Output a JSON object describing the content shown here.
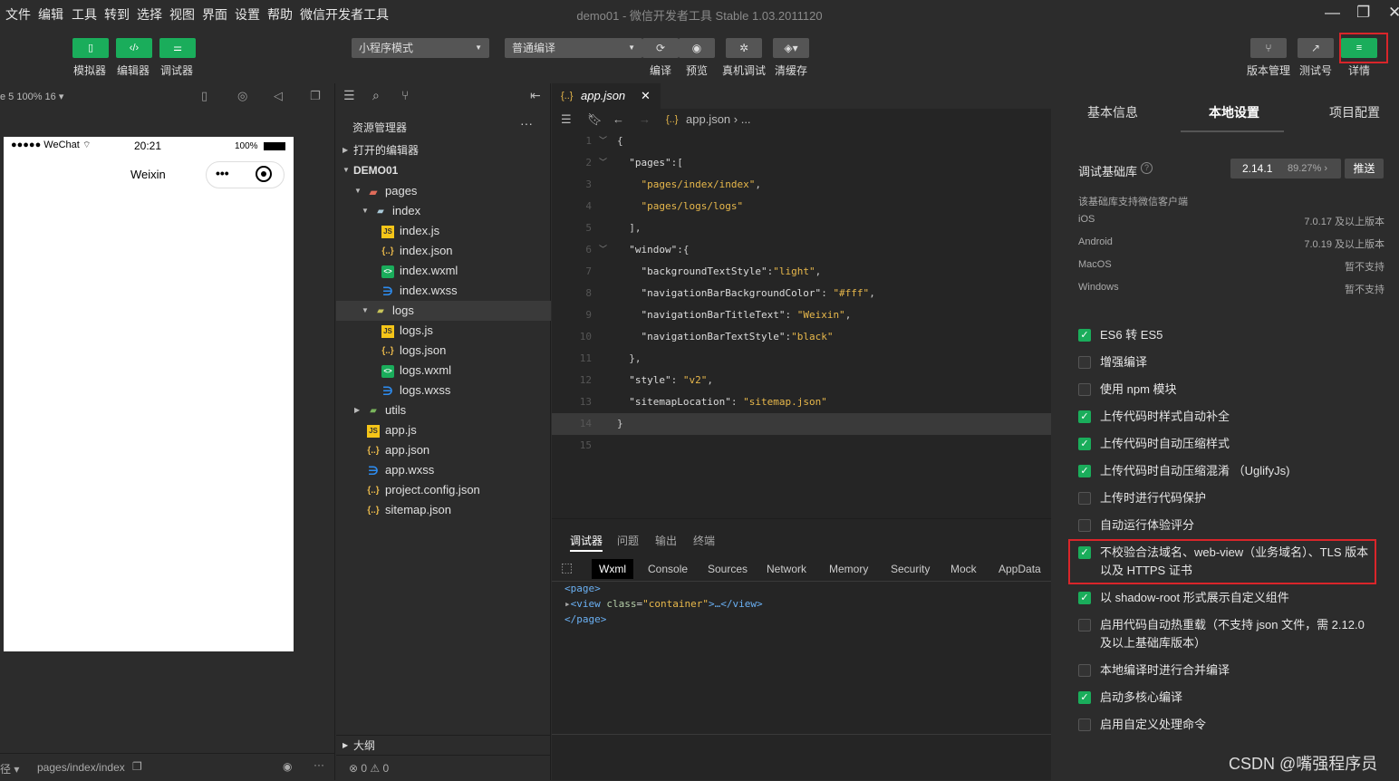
{
  "menubar": {
    "items": [
      "文件",
      "编辑",
      "工具",
      "转到",
      "选择",
      "视图",
      "界面",
      "设置",
      "帮助",
      "微信开发者工具"
    ],
    "title": "demo01 - 微信开发者工具 Stable 1.03.2011120"
  },
  "toolbar": {
    "simulator": "模拟器",
    "editor": "编辑器",
    "debugger": "调试器",
    "mode_select": "小程序模式",
    "compile_select": "普通编译",
    "compile": "编译",
    "preview": "预览",
    "real_debug": "真机调试",
    "clear_cache": "清缓存",
    "version_mgmt": "版本管理",
    "test_id": "测试号",
    "details": "详情"
  },
  "simulator": {
    "zoom": "e 5 100% 16 ▾",
    "carrier": "●●●●● WeChat",
    "time": "20:21",
    "battery": "100%",
    "nav_title": "Weixin",
    "footer_left": "径 ▾",
    "footer_path": "pages/index/index"
  },
  "explorer": {
    "title": "资源管理器",
    "more": "···",
    "open_editors": "打开的编辑器",
    "project": "DEMO01",
    "tree": [
      {
        "label": "pages",
        "type": "folder",
        "level": 1
      },
      {
        "label": "index",
        "type": "folder2",
        "level": 2
      },
      {
        "label": "index.js",
        "type": "js",
        "level": 3
      },
      {
        "label": "index.json",
        "type": "json",
        "level": 3
      },
      {
        "label": "index.wxml",
        "type": "wxml",
        "level": 3
      },
      {
        "label": "index.wxss",
        "type": "wxss",
        "level": 3
      },
      {
        "label": "logs",
        "type": "folder3",
        "level": 2
      },
      {
        "label": "logs.js",
        "type": "js",
        "level": 3
      },
      {
        "label": "logs.json",
        "type": "json",
        "level": 3
      },
      {
        "label": "logs.wxml",
        "type": "wxml",
        "level": 3
      },
      {
        "label": "logs.wxss",
        "type": "wxss",
        "level": 3
      },
      {
        "label": "utils",
        "type": "folder4",
        "level": 1
      },
      {
        "label": "app.js",
        "type": "js",
        "level": 1
      },
      {
        "label": "app.json",
        "type": "json",
        "level": 1
      },
      {
        "label": "app.wxss",
        "type": "wxss",
        "level": 1
      },
      {
        "label": "project.config.json",
        "type": "json",
        "level": 1
      },
      {
        "label": "sitemap.json",
        "type": "json",
        "level": 1
      }
    ],
    "outline": "大纲",
    "status": "⊗ 0 ⚠ 0"
  },
  "editor": {
    "tab": "app.json",
    "breadcrumb": "app.json › ...",
    "lines": [
      {
        "n": "1",
        "code": "{"
      },
      {
        "n": "2",
        "code": "  \"pages\":["
      },
      {
        "n": "3",
        "code": "    \"pages/index/index\","
      },
      {
        "n": "4",
        "code": "    \"pages/logs/logs\""
      },
      {
        "n": "5",
        "code": "  ],"
      },
      {
        "n": "6",
        "code": "  \"window\":{"
      },
      {
        "n": "7",
        "code": "    \"backgroundTextStyle\":\"light\","
      },
      {
        "n": "8",
        "code": "    \"navigationBarBackgroundColor\": \"#fff\","
      },
      {
        "n": "9",
        "code": "    \"navigationBarTitleText\": \"Weixin\","
      },
      {
        "n": "10",
        "code": "    \"navigationBarTextStyle\":\"black\""
      },
      {
        "n": "11",
        "code": "  },"
      },
      {
        "n": "12",
        "code": "  \"style\": \"v2\","
      },
      {
        "n": "13",
        "code": "  \"sitemapLocation\": \"sitemap.json\""
      },
      {
        "n": "14",
        "code": "}"
      },
      {
        "n": "15",
        "code": ""
      }
    ]
  },
  "debugger": {
    "tabs": [
      "调试器",
      "问题",
      "输出",
      "终端"
    ],
    "devtools_tabs": [
      "Wxml",
      "Console",
      "Sources",
      "Network",
      "Memory",
      "Security",
      "Mock",
      "AppData"
    ],
    "xml": [
      "<page>",
      "▸<view class=\"container\">…</view>",
      "</page>"
    ]
  },
  "settings": {
    "tabs": [
      "基本信息",
      "本地设置",
      "项目配置"
    ],
    "lib_label": "调试基础库",
    "lib_version": "2.14.1",
    "lib_percent": "89.27% ›",
    "push": "推送",
    "support_title": "该基础库支持微信客户端",
    "support": [
      {
        "os": "iOS",
        "val": "7.0.17 及以上版本"
      },
      {
        "os": "Android",
        "val": "7.0.19 及以上版本"
      },
      {
        "os": "MacOS",
        "val": "暂不支持"
      },
      {
        "os": "Windows",
        "val": "暂不支持"
      }
    ],
    "options": [
      {
        "label": "ES6 转 ES5",
        "checked": true
      },
      {
        "label": "增强编译",
        "checked": false
      },
      {
        "label": "使用 npm 模块",
        "checked": false
      },
      {
        "label": "上传代码时样式自动补全",
        "checked": true
      },
      {
        "label": "上传代码时自动压缩样式",
        "checked": true
      },
      {
        "label": "上传代码时自动压缩混淆 （UglifyJs)",
        "checked": true
      },
      {
        "label": "上传时进行代码保护",
        "checked": false
      },
      {
        "label": "自动运行体验评分",
        "checked": false
      },
      {
        "label": "不校验合法域名、web-view（业务域名）、TLS 版本以及 HTTPS 证书",
        "checked": true
      },
      {
        "label": "以 shadow-root 形式展示自定义组件",
        "checked": true
      },
      {
        "label": "启用代码自动热重载（不支持 json 文件，需 2.12.0 及以上基础库版本）",
        "checked": false
      },
      {
        "label": "本地编译时进行合并编译",
        "checked": false
      },
      {
        "label": "启动多核心编译",
        "checked": true
      },
      {
        "label": "启用自定义处理命令",
        "checked": false
      }
    ]
  },
  "watermark": "CSDN @嘴强程序员"
}
